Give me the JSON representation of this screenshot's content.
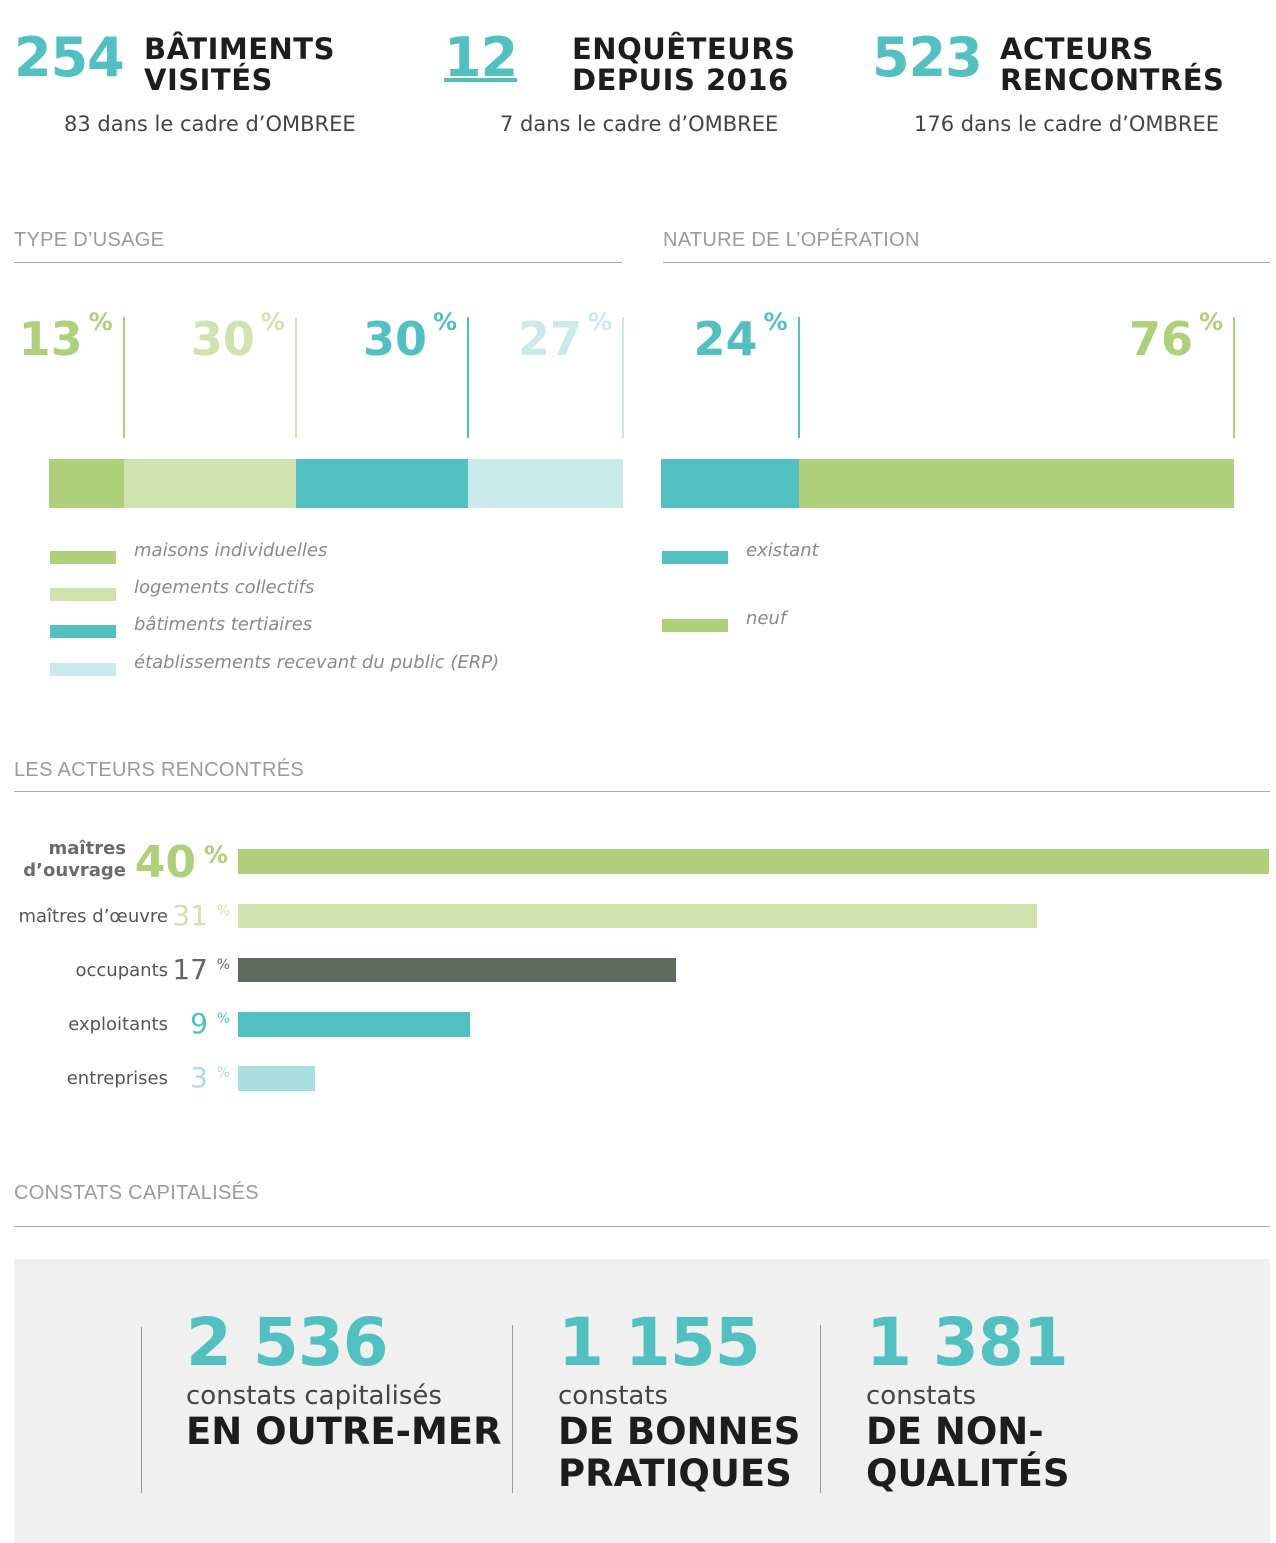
{
  "colors": {
    "green": "#aed07a",
    "light_green": "#cfe2b0",
    "teal": "#52c0c1",
    "light_teal": "#cae9eb",
    "pale_teal": "#a9dfe0",
    "dark_gray": "#5e6a5a",
    "text_dark": "#1d1d1b",
    "section_gray": "#9a9a9a"
  },
  "top_stats": [
    {
      "value": "254",
      "line1": "BÂTIMENTS",
      "line2": "VISITÉS",
      "sub": "83 dans le cadre d’OMBREE"
    },
    {
      "value": "12",
      "line1": "ENQUÊTEURS",
      "line2": "DEPUIS 2016",
      "sub": "7 dans le cadre d’OMBREE"
    },
    {
      "value": "523",
      "line1": "ACTEURS",
      "line2": "RENCONTRÉS",
      "sub": "176 dans le cadre d’OMBREE"
    }
  ],
  "sections": {
    "usage": "TYPE D’USAGE",
    "operation": "NATURE DE L’OPÉRATION",
    "acteurs": "LES ACTEURS RENCONTRÉS",
    "constats": "CONSTATS CAPITALISÉS"
  },
  "percent_sign": "%",
  "chart_data": [
    {
      "type": "bar",
      "stacked": true,
      "orientation": "horizontal",
      "title": "TYPE D’USAGE",
      "categories": [
        "maisons individuelles",
        "logements collectifs",
        "bâtiments tertiaires",
        "établissements recevant du public (ERP)"
      ],
      "values": [
        13,
        30,
        30,
        27
      ],
      "labels": [
        "13",
        "30",
        "30",
        "27"
      ],
      "colors": [
        "#aed07a",
        "#cfe2b0",
        "#52c0c1",
        "#cae9eb"
      ],
      "legend": "bottom"
    },
    {
      "type": "bar",
      "stacked": true,
      "orientation": "horizontal",
      "title": "NATURE DE L’OPÉRATION",
      "categories": [
        "existant",
        "neuf"
      ],
      "values": [
        24,
        76
      ],
      "labels": [
        "24",
        "76"
      ],
      "colors": [
        "#52c0c1",
        "#aed07a"
      ],
      "legend": "bottom"
    },
    {
      "type": "bar",
      "orientation": "horizontal",
      "title": "LES ACTEURS RENCONTRÉS",
      "categories": [
        "maîtres d’ouvrage",
        "maîtres d’œuvre",
        "occupants",
        "exploitants",
        "entreprises"
      ],
      "category_lines": [
        [
          "maîtres",
          "d’ouvrage"
        ],
        [
          "maîtres d’œuvre"
        ],
        [
          "occupants"
        ],
        [
          "exploitants"
        ],
        [
          "entreprises"
        ]
      ],
      "values": [
        40,
        31,
        17,
        9,
        3
      ],
      "labels": [
        "40",
        "31",
        "17",
        "9",
        "3"
      ],
      "colors": [
        "#aed07a",
        "#cfe2b0",
        "#5e6a5a",
        "#52c0c1",
        "#a9dfe0"
      ],
      "xlim": [
        0,
        40
      ]
    }
  ],
  "constats": [
    {
      "value": "2 536",
      "sub": "constats capitalisés",
      "head": [
        "EN OUTRE-MER"
      ]
    },
    {
      "value": "1 155",
      "sub": "constats",
      "head": [
        "DE BONNES",
        "PRATIQUES"
      ]
    },
    {
      "value": "1 381",
      "sub": "constats",
      "head": [
        "DE NON-",
        "QUALITÉS"
      ]
    }
  ]
}
